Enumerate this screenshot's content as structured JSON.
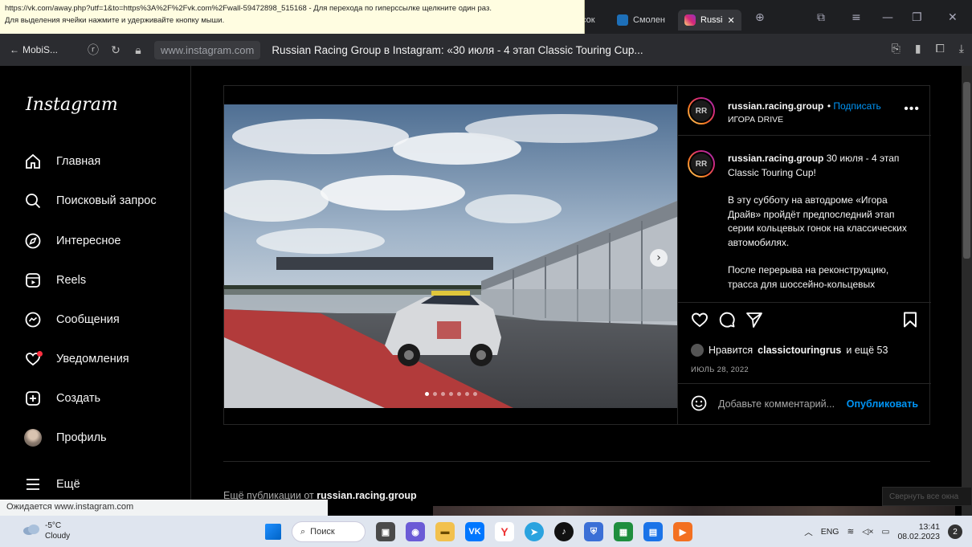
{
  "browser": {
    "tooltip_line1": "https://vk.com/away.php?utf=1&to=https%3A%2F%2Fvk.com%2Fwall-59472898_515168 - Для перехода по гиперссылке щелкните один раз.",
    "tooltip_line2": "Для выделения ячейки нажмите и удерживайте кнопку мыши.",
    "tabs": [
      {
        "label": "сок"
      },
      {
        "label": "Смолен"
      },
      {
        "label": "Russi"
      }
    ],
    "back_label": "MobiS...",
    "url": "www.instagram.com",
    "page_title": "Russian Racing Group в Instagram: «30 июля - 4 этап Classic Touring Cup..."
  },
  "sidebar": {
    "logo": "Instagram",
    "items": [
      {
        "label": "Главная",
        "icon": "home-icon"
      },
      {
        "label": "Поисковый запрос",
        "icon": "search-icon"
      },
      {
        "label": "Интересное",
        "icon": "compass-icon"
      },
      {
        "label": "Reels",
        "icon": "reels-icon"
      },
      {
        "label": "Сообщения",
        "icon": "messenger-icon"
      },
      {
        "label": "Уведомления",
        "icon": "heart-icon"
      },
      {
        "label": "Создать",
        "icon": "plus-square-icon"
      },
      {
        "label": "Профиль",
        "icon": "profile-avatar-icon"
      },
      {
        "label": "Ещё",
        "icon": "menu-icon"
      }
    ]
  },
  "post": {
    "username": "russian.racing.group",
    "follow_label": "Подписать",
    "location": "ИГОРА DRIVE",
    "caption_user": "russian.racing.group",
    "caption_first": "30 июля - 4 этап Classic Touring Cup!",
    "caption_p2": "В эту субботу на автодроме «Игора Драйв» пройдёт предпоследний этап серии кольцевых гонок на классических автомобилях.",
    "caption_p3": "После перерыва на реконструкцию, трасса для шоссейно-кольцевых",
    "likes_prefix": "Нравится",
    "likes_user": "classictouringrus",
    "likes_suffix": "и ещё 53",
    "date": "ИЮЛЬ 28, 2022",
    "comment_placeholder": "Добавьте комментарий...",
    "publish_label": "Опубликовать"
  },
  "more_posts": {
    "prefix": "Ещё публикации от",
    "user": "russian.racing.group"
  },
  "status": {
    "loading": "Ожидается www.instagram.com",
    "collapse_hint": "Свернуть все окна"
  },
  "taskbar": {
    "temp": "-5°C",
    "weather": "Cloudy",
    "search_label": "Поиск",
    "lang": "ENG",
    "time": "13:41",
    "date": "08.02.2023",
    "notifications": "2"
  },
  "colors": {
    "accent_blue": "#0095f6",
    "background": "#000000",
    "taskbar": "#dfe5ef"
  }
}
